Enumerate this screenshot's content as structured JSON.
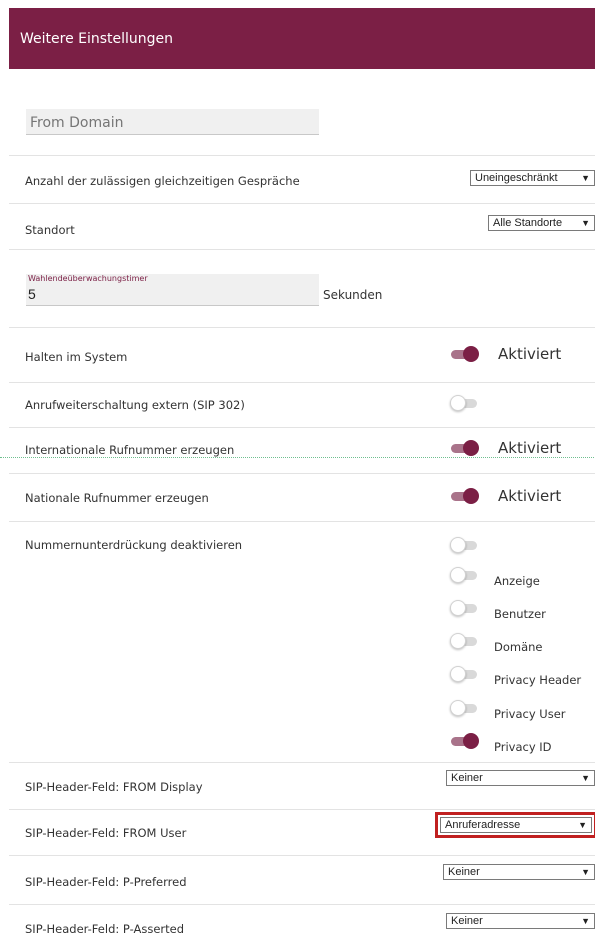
{
  "section_title": "Weitere Einstellungen",
  "from_domain": {
    "placeholder": "From Domain",
    "value": ""
  },
  "concurrent_calls": {
    "label": "Anzahl der zulässigen gleichzeitigen Gespräche",
    "selected": "Uneingeschränkt"
  },
  "location": {
    "label": "Standort",
    "selected": "Alle Standorte"
  },
  "dial_timer": {
    "label": "Wahlendeüberwachungstimer",
    "value": "5",
    "unit": "Sekunden"
  },
  "hold_in_system": {
    "label": "Halten im System",
    "enabled": true,
    "status": "Aktiviert"
  },
  "call_forward_external": {
    "label": "Anrufweiterschaltung extern (SIP 302)",
    "enabled": false
  },
  "international_number": {
    "label": "Internationale Rufnummer erzeugen",
    "enabled": true,
    "status": "Aktiviert"
  },
  "national_number": {
    "label": "Nationale Rufnummer erzeugen",
    "enabled": true,
    "status": "Aktiviert"
  },
  "number_suppression": {
    "label": "Nummernunterdrückung deaktivieren",
    "enabled": false,
    "options": [
      {
        "label": "Anzeige",
        "enabled": false
      },
      {
        "label": "Benutzer",
        "enabled": false
      },
      {
        "label": "Domäne",
        "enabled": false
      },
      {
        "label": "Privacy Header",
        "enabled": false
      },
      {
        "label": "Privacy User",
        "enabled": false
      },
      {
        "label": "Privacy ID",
        "enabled": true
      }
    ]
  },
  "from_display": {
    "label": "SIP-Header-Feld: FROM Display",
    "selected": "Keiner"
  },
  "from_user": {
    "label": "SIP-Header-Feld: FROM User",
    "selected": "Anruferadresse"
  },
  "p_preferred": {
    "label": "SIP-Header-Feld: P-Preferred",
    "selected": "Keiner"
  },
  "p_asserted": {
    "label": "SIP-Header-Feld: P-Asserted",
    "selected": "Keiner"
  },
  "colors": {
    "accent": "#7b1f45",
    "highlight": "#c02020"
  }
}
